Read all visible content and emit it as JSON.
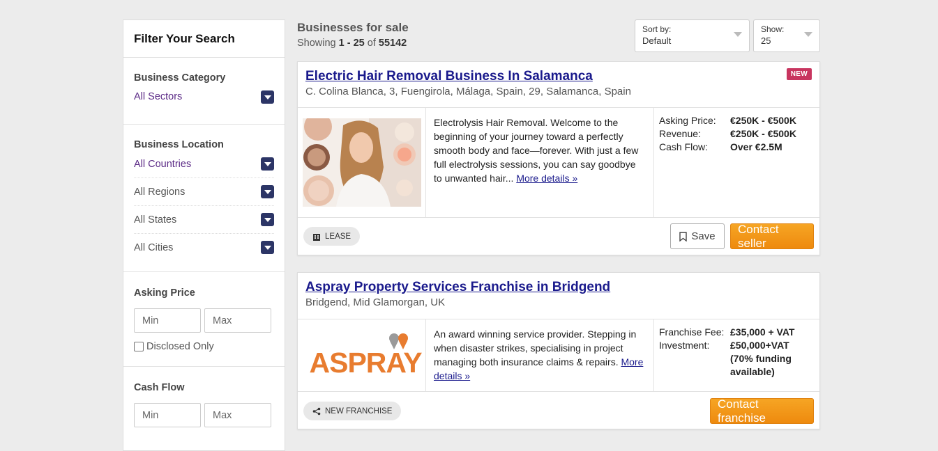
{
  "sidebar": {
    "heading": "Filter Your Search",
    "category": {
      "label": "Business Category",
      "value": "All Sectors"
    },
    "location": {
      "label": "Business Location",
      "countries": "All Countries",
      "regions": "All Regions",
      "states": "All States",
      "cities": "All Cities"
    },
    "asking_price": {
      "label": "Asking Price",
      "min_placeholder": "Min",
      "max_placeholder": "Max",
      "disclosed_only": "Disclosed Only"
    },
    "cash_flow": {
      "label": "Cash Flow",
      "min_placeholder": "Min",
      "max_placeholder": "Max"
    }
  },
  "results": {
    "title": "Businesses for sale",
    "showing_prefix": "Showing",
    "range": "1 - 25",
    "of": "of",
    "total": "55142"
  },
  "sort": {
    "label": "Sort by:",
    "value": "Default"
  },
  "show": {
    "label": "Show:",
    "value": "25"
  },
  "listings": [
    {
      "title": "Electric Hair Removal Business In Salamanca",
      "location": "C. Colina Blanca, 3, Fuengirola, Málaga, Spain, 29, Salamanca, Spain",
      "badge": "NEW",
      "description": "Electrolysis Hair Removal. Welcome to the beginning of your journey toward a perfectly smooth body and face—forever. With just a few full electrolysis sessions, you can say goodbye to unwanted hair...",
      "more": "More details »",
      "financials": [
        {
          "key": "Asking Price:",
          "value": "€250K - €500K"
        },
        {
          "key": "Revenue:",
          "value": "€250K - €500K"
        },
        {
          "key": "Cash Flow:",
          "value": "Over €2.5M"
        }
      ],
      "tag": "LEASE",
      "tag_icon": "building-icon",
      "save": "Save",
      "contact": "Contact seller"
    },
    {
      "title": "Aspray Property Services Franchise in Bridgend",
      "location": "Bridgend, Mid Glamorgan, UK",
      "description": "An award winning service provider. Stepping in when disaster strikes, specialising in project managing both insurance claims & repairs.",
      "more": "More details »",
      "logo_text": "ASPRAY",
      "financials": [
        {
          "key": "Franchise Fee:",
          "value": "£35,000 + VAT"
        },
        {
          "key": "Investment:",
          "value": "£50,000+VAT (70% funding available)"
        }
      ],
      "tag": "NEW FRANCHISE",
      "tag_icon": "share-icon",
      "contact": "Contact franchise"
    }
  ],
  "colors": {
    "accent_orange": "#f39a1a",
    "title_blue": "#1a1a8c",
    "badge_pink": "#c8355f",
    "dropdown_navy": "#2c3566",
    "aspray_orange": "#e87c2f"
  }
}
